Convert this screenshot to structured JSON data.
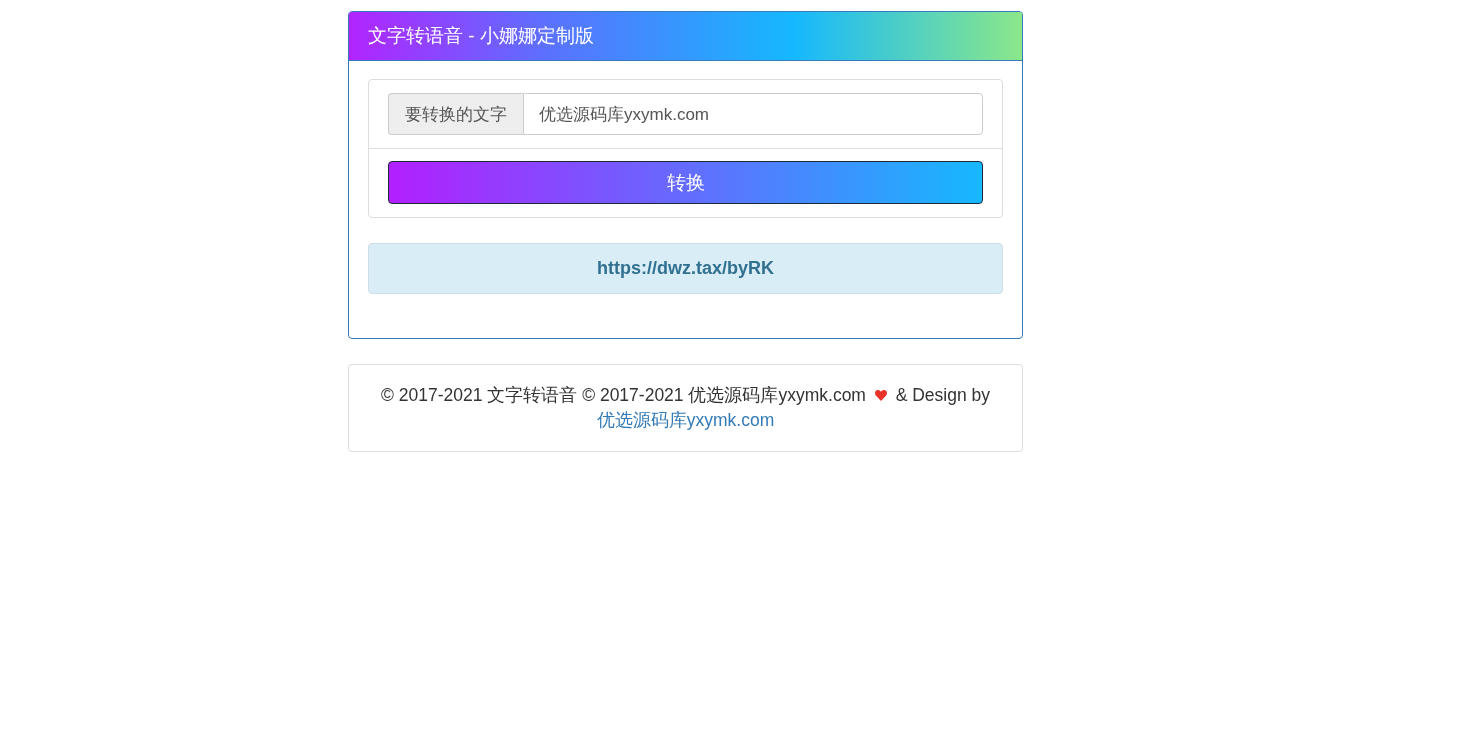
{
  "header": {
    "title": "文字转语音 - 小娜娜定制版"
  },
  "form": {
    "label": "要转换的文字",
    "input": {
      "value": "优选源码库yxymk.com"
    },
    "button": "转换"
  },
  "result": {
    "link": "https://dwz.tax/byRK"
  },
  "footer": {
    "text": "© 2017-2021 文字转语音 © 2017-2021 优选源码库yxymk.com",
    "text_after_icon": "& Design by",
    "link": "优选源码库yxymk.com"
  }
}
